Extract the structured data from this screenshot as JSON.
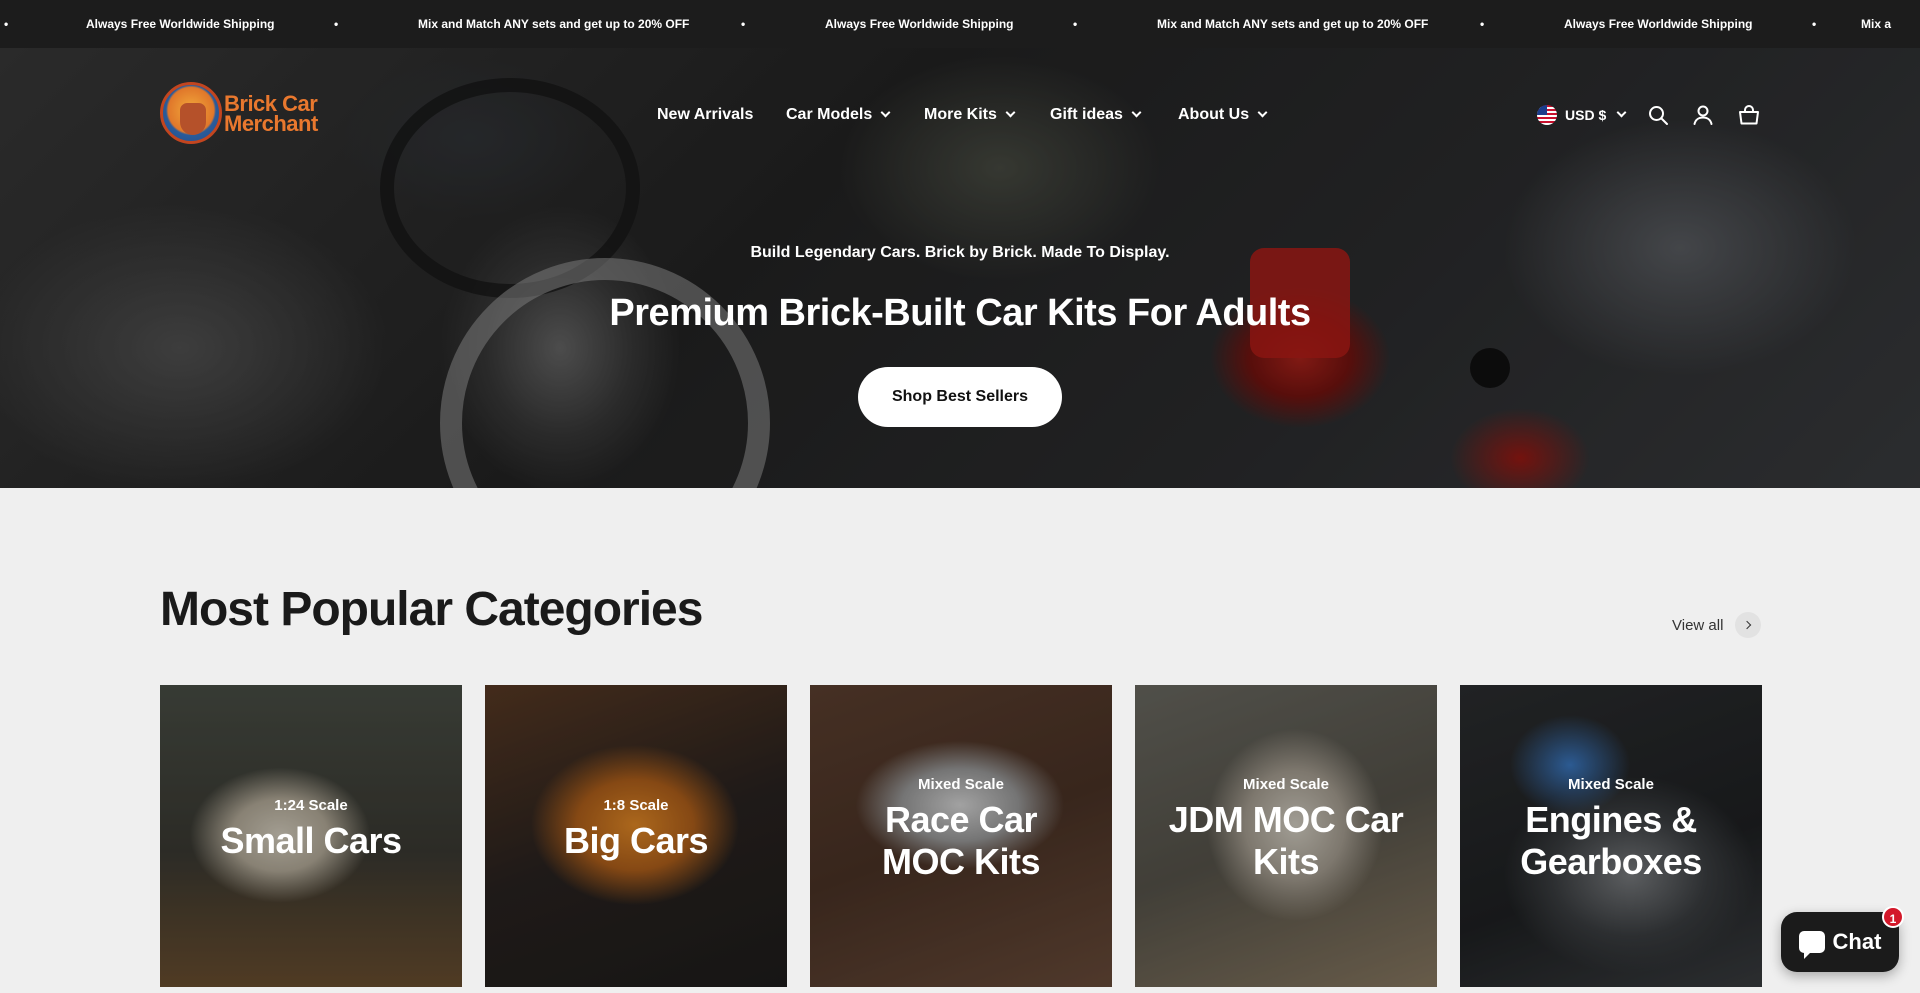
{
  "announcement": {
    "messages": [
      "Always Free Worldwide Shipping",
      "Mix and Match ANY sets and get up to 20% OFF",
      "Always Free Worldwide Shipping",
      "Mix and Match ANY sets and get up to 20% OFF",
      "Always Free Worldwide Shipping",
      "Mix a"
    ],
    "separator": "•"
  },
  "header": {
    "logo": {
      "line1": "Brick Car",
      "line2": "Merchant"
    },
    "nav": [
      {
        "label": "New Arrivals",
        "has_dropdown": false
      },
      {
        "label": "Car Models",
        "has_dropdown": true
      },
      {
        "label": "More Kits",
        "has_dropdown": true
      },
      {
        "label": "Gift ideas",
        "has_dropdown": true
      },
      {
        "label": "About Us",
        "has_dropdown": true
      }
    ],
    "currency": "USD $",
    "icons": [
      "search-icon",
      "account-icon",
      "cart-icon"
    ]
  },
  "hero": {
    "subtitle": "Build Legendary Cars. Brick by Brick. Made To Display.",
    "title": "Premium Brick-Built Car Kits For Adults",
    "button": "Shop Best Sellers"
  },
  "categories": {
    "title": "Most Popular Categories",
    "view_all": "View all",
    "items": [
      {
        "scale": "1:24 Scale",
        "name": "Small Cars"
      },
      {
        "scale": "1:8 Scale",
        "name": "Big Cars"
      },
      {
        "scale": "Mixed Scale",
        "name": "Race Car MOC Kits",
        "line1": "Race Car",
        "line2": "MOC Kits"
      },
      {
        "scale": "Mixed Scale",
        "name": "JDM MOC Car Kits",
        "line1": "JDM MOC Car",
        "line2": "Kits"
      },
      {
        "scale": "Mixed Scale",
        "name": "Engines & Gearboxes",
        "line1": "Engines &",
        "line2": "Gearboxes"
      }
    ]
  },
  "chat": {
    "label": "Chat",
    "badge": "1"
  },
  "colors": {
    "announcement_bg": "#1c1c1c",
    "page_bg": "#efefef",
    "logo_orange": "#e9782e",
    "badge_red": "#d3182a"
  }
}
